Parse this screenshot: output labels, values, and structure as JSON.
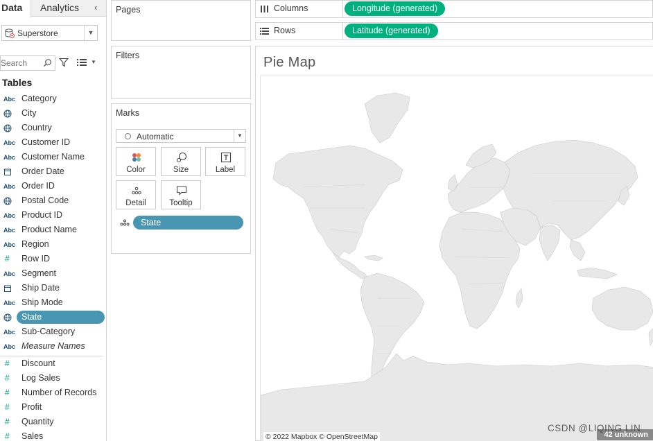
{
  "data_pane": {
    "tabs": [
      "Data",
      "Analytics"
    ],
    "collapse_glyph": "‹",
    "datasource": "Superstore",
    "search_placeholder": "Search",
    "tables_heading": "Tables",
    "fields": [
      {
        "icon": "Abc",
        "label": "Category",
        "kind": "string"
      },
      {
        "icon": "globe",
        "label": "City",
        "kind": "geo"
      },
      {
        "icon": "globe",
        "label": "Country",
        "kind": "geo"
      },
      {
        "icon": "Abc",
        "label": "Customer ID",
        "kind": "string"
      },
      {
        "icon": "Abc",
        "label": "Customer Name",
        "kind": "string"
      },
      {
        "icon": "calendar",
        "label": "Order Date",
        "kind": "date"
      },
      {
        "icon": "Abc",
        "label": "Order ID",
        "kind": "string"
      },
      {
        "icon": "globe",
        "label": "Postal Code",
        "kind": "geo"
      },
      {
        "icon": "Abc",
        "label": "Product ID",
        "kind": "string"
      },
      {
        "icon": "Abc",
        "label": "Product Name",
        "kind": "string"
      },
      {
        "icon": "Abc",
        "label": "Region",
        "kind": "string"
      },
      {
        "icon": "#",
        "label": "Row ID",
        "kind": "number"
      },
      {
        "icon": "Abc",
        "label": "Segment",
        "kind": "string"
      },
      {
        "icon": "calendar",
        "label": "Ship Date",
        "kind": "date"
      },
      {
        "icon": "Abc",
        "label": "Ship Mode",
        "kind": "string"
      },
      {
        "icon": "globe",
        "label": "State",
        "kind": "geo",
        "selected": true
      },
      {
        "icon": "Abc",
        "label": "Sub-Category",
        "kind": "string"
      },
      {
        "icon": "Abc",
        "label": "Measure Names",
        "kind": "string",
        "italic": true
      }
    ],
    "measures": [
      {
        "icon": "#",
        "label": "Discount"
      },
      {
        "icon": "#",
        "label": "Log Sales"
      },
      {
        "icon": "#",
        "label": "Number of Records"
      },
      {
        "icon": "#",
        "label": "Profit"
      },
      {
        "icon": "#",
        "label": "Quantity"
      },
      {
        "icon": "#",
        "label": "Sales"
      }
    ]
  },
  "cards": {
    "pages_title": "Pages",
    "filters_title": "Filters",
    "marks_title": "Marks",
    "mark_type": "Automatic",
    "mark_buttons": {
      "color": "Color",
      "size": "Size",
      "label": "Label",
      "detail": "Detail",
      "tooltip": "Tooltip"
    },
    "mark_pill": "State"
  },
  "shelves": {
    "columns_label": "Columns",
    "columns_pill": "Longitude (generated)",
    "rows_label": "Rows",
    "rows_pill": "Latitude (generated)"
  },
  "view": {
    "sheet_title": "Pie Map",
    "map_attribution": "© 2022 Mapbox © OpenStreetMap",
    "unknown_badge": "42 unknown"
  },
  "watermark": "CSDN @LIQING LIN",
  "colors": {
    "accent_blue": "#4996b2",
    "pill_green": "#00b180",
    "land": "#e6e6e6",
    "border": "#d4d4d4"
  }
}
